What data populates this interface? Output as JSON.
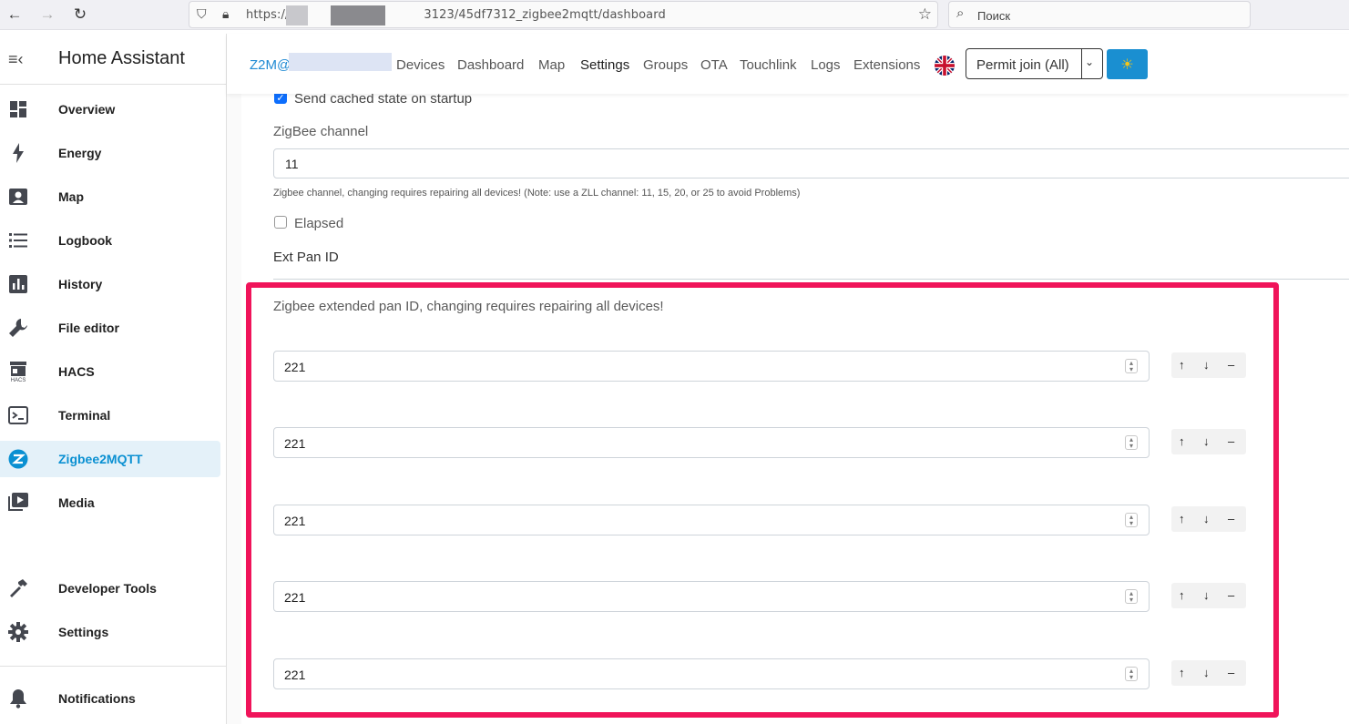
{
  "browser": {
    "url": "https://",
    "url_tail": "3123/45df7312_zigbee2mqtt/dashboard",
    "search_placeholder": "Поиск"
  },
  "sidebar": {
    "title": "Home Assistant",
    "items": [
      {
        "label": "Overview",
        "icon": "dashboard-icon"
      },
      {
        "label": "Energy",
        "icon": "lightning-icon"
      },
      {
        "label": "Map",
        "icon": "account-box-icon"
      },
      {
        "label": "Logbook",
        "icon": "list-icon"
      },
      {
        "label": "History",
        "icon": "chart-box-icon"
      },
      {
        "label": "File editor",
        "icon": "wrench-icon"
      },
      {
        "label": "HACS",
        "icon": "hacs-store-icon"
      },
      {
        "label": "Terminal",
        "icon": "console-icon"
      },
      {
        "label": "Zigbee2MQTT",
        "icon": "zigbee-icon",
        "active": true
      },
      {
        "label": "Media",
        "icon": "play-box-icon"
      },
      {
        "label": "Developer Tools",
        "icon": "hammer-icon"
      },
      {
        "label": "Settings",
        "icon": "cog-icon"
      },
      {
        "label": "Notifications",
        "icon": "bell-icon"
      }
    ]
  },
  "z2m": {
    "brand": "Z2M@",
    "nav": [
      "Devices",
      "Dashboard",
      "Map",
      "Settings",
      "Groups",
      "OTA",
      "Touchlink",
      "Logs",
      "Extensions"
    ],
    "active_nav": "Settings",
    "permit_join": "Permit join (All)"
  },
  "form": {
    "send_cached_label": "Send cached state on startup",
    "send_cached_checked": true,
    "channel_label": "ZigBee channel",
    "channel_value": "11",
    "channel_help": "Zigbee channel, changing requires repairing all devices! (Note: use a ZLL channel: 11, 15, 20, or 25 to avoid Problems)",
    "elapsed_label": "Elapsed",
    "elapsed_checked": false,
    "ext_pan_label": "Ext Pan ID",
    "ext_pan_help": "Zigbee extended pan ID, changing requires repairing all devices!",
    "ext_pan_values": [
      "221",
      "221",
      "221",
      "221",
      "221"
    ],
    "row_actions": {
      "up": "↑",
      "down": "↓",
      "remove": "–"
    }
  },
  "colors": {
    "accent": "#1f8ad3",
    "highlight": "#f0145a",
    "active_bg": "#e4f1f9"
  }
}
